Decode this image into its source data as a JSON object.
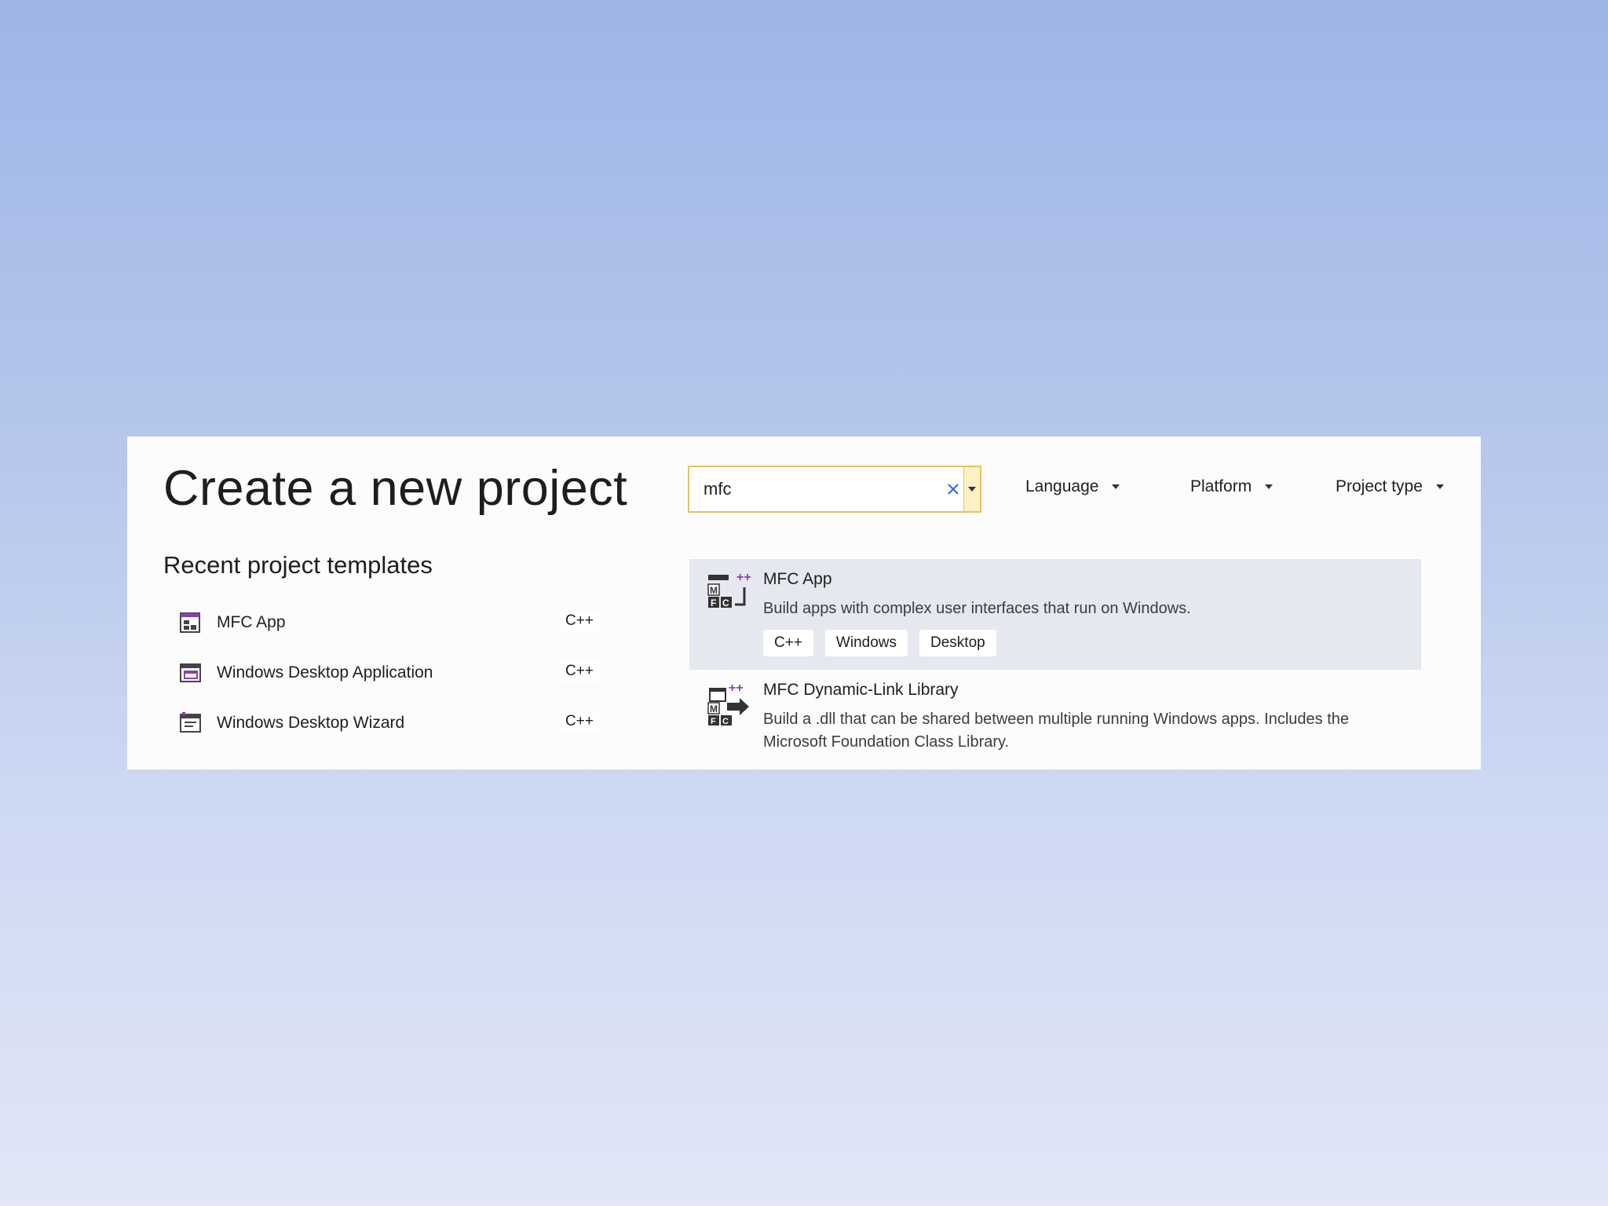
{
  "header": {
    "title": "Create a new project"
  },
  "recent": {
    "title": "Recent project templates",
    "items": [
      {
        "label": "MFC App",
        "language": "C++"
      },
      {
        "label": "Windows Desktop Application",
        "language": "C++"
      },
      {
        "label": "Windows Desktop Wizard",
        "language": "C++"
      }
    ]
  },
  "search": {
    "value": "mfc",
    "placeholder": ""
  },
  "filters": {
    "language": "Language",
    "platform": "Platform",
    "project_type": "Project type"
  },
  "results": [
    {
      "title": "MFC App",
      "description": "Build apps with complex user interfaces that run on Windows.",
      "tags": [
        "C++",
        "Windows",
        "Desktop"
      ]
    },
    {
      "title": "MFC Dynamic-Link Library",
      "description": "Build a .dll that can be shared between multiple running Windows apps. Includes the Microsoft Foundation Class Library.",
      "tags": []
    }
  ],
  "icons": {
    "template_icon_left": "mfc-app-small-icon",
    "template_icon_desktop": "window-icon",
    "template_icon_wizard": "wizard-icon",
    "result_icon_app": "mfc-app-icon",
    "result_icon_dll": "mfc-dll-icon",
    "clear": "close-icon",
    "caret": "caret-down-icon"
  },
  "colors": {
    "search_border": "#e5c365",
    "selected_row": "#e6e8ef",
    "icon_accent": "#8a3fb0"
  }
}
